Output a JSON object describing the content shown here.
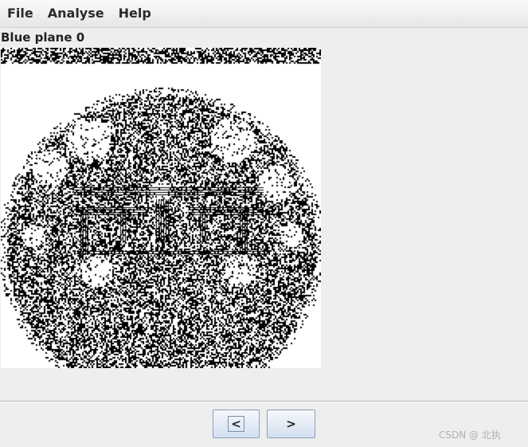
{
  "menubar": {
    "items": [
      {
        "label": "File"
      },
      {
        "label": "Analyse"
      },
      {
        "label": "Help"
      }
    ]
  },
  "panel": {
    "title": "Blue plane 0"
  },
  "navigation": {
    "prev_label": "<",
    "next_label": ">"
  },
  "watermark": {
    "text": "CSDN @    北执"
  },
  "colors": {
    "background": "#eeeeee",
    "image_background": "#ffffff",
    "image_foreground": "#000000",
    "button_border": "#8aa0bb"
  }
}
